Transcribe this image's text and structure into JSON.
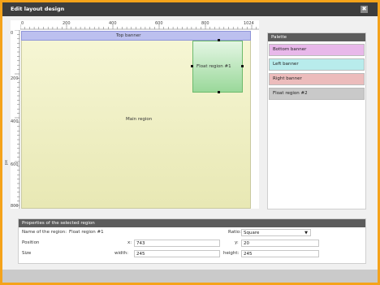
{
  "window": {
    "title": "Edit layout design",
    "close_glyph": "✖"
  },
  "ruler": {
    "top_ticks": [
      "0",
      "200",
      "400",
      "600",
      "800",
      "1024"
    ],
    "left_ticks": [
      "0",
      "200",
      "400",
      "600",
      "800"
    ],
    "unit_label": "px"
  },
  "regions": {
    "top_banner": "Top banner",
    "main_region": "Main region",
    "float_region": "Float region #1"
  },
  "palette": {
    "header": "Palette",
    "items": [
      {
        "label": "Bottom banner",
        "color": "#e8b8ea"
      },
      {
        "label": "Left banner",
        "color": "#b8ecec"
      },
      {
        "label": "Right banner",
        "color": "#ecbcbc"
      },
      {
        "label": "Float region #2",
        "color": "#c9c9c9"
      }
    ]
  },
  "properties": {
    "header": "Properties of the selected region",
    "name_label": "Name of the region:",
    "name_value": "Float region #1",
    "ratio_label": "Ratio:",
    "ratio_value": "Square",
    "position_label": "Position",
    "x_label": "x:",
    "x_value": "743",
    "y_label": "y:",
    "y_value": "20",
    "size_label": "Size",
    "width_label": "width:",
    "width_value": "245",
    "height_label": "height:",
    "height_value": "245"
  }
}
